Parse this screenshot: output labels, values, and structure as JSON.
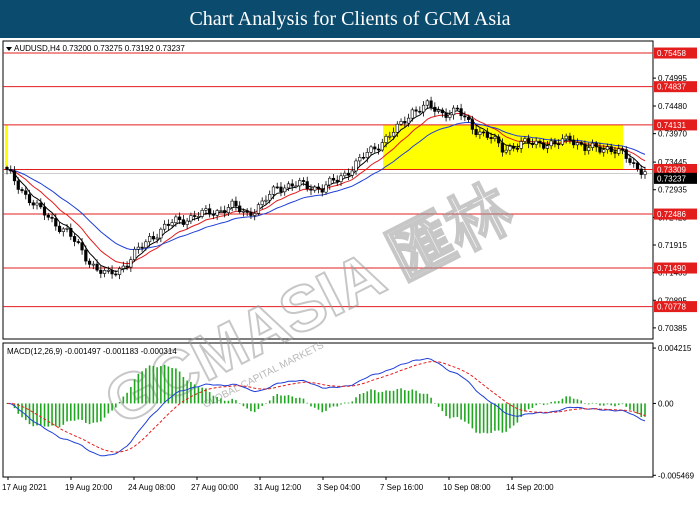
{
  "header": {
    "title": "Chart Analysis for Clients of GCM Asia"
  },
  "watermark": {
    "text": "GCMASIA 匯林",
    "sub": "GLOBAL CAPITAL MARKETS"
  },
  "chart_data": [
    {
      "type": "candlestick",
      "title": "AUDUSD,H4 0.73200 0.73275 0.73192 0.73237",
      "symbol_label": "AUDUSD,H4",
      "ohlc": {
        "open": 0.732,
        "high": 0.73275,
        "low": 0.73192,
        "close": 0.73237
      },
      "x_tick_labels": [
        "17 Aug 2021",
        "19 Aug 20:00",
        "24 Aug 08:00",
        "27 Aug 00:00",
        "31 Aug 12:00",
        "3 Sep 04:00",
        "7 Sep 16:00",
        "10 Sep 08:00",
        "14 Sep 20:00"
      ],
      "y_tick_labels": [
        "0.74995",
        "0.74480",
        "0.73970",
        "0.73445",
        "0.72935",
        "0.72425",
        "0.71915",
        "0.71405",
        "0.70895",
        "0.70385"
      ],
      "y_ticks": [
        0.74995,
        0.7448,
        0.7397,
        0.73445,
        0.72935,
        0.72425,
        0.71915,
        0.71405,
        0.70895,
        0.70385
      ],
      "ylim": [
        0.7018,
        0.7568
      ],
      "horizontal_levels": [
        0.75458,
        0.74837,
        0.74131,
        0.73309,
        0.72486,
        0.7149,
        0.70778
      ],
      "horizontal_level_labels": [
        "0.75458",
        "0.74837",
        "0.74131",
        "0.73309",
        "0.72486",
        "0.71490",
        "0.70778"
      ],
      "current_price_label": "0.73237",
      "current_price": 0.73237,
      "highlight_zone": {
        "from": 0.73309,
        "to": 0.74131,
        "color": "#ffff00"
      },
      "moving_averages": [
        {
          "color": "#000000"
        },
        {
          "color": "#e31c1c"
        },
        {
          "color": "#1f3fd6"
        }
      ],
      "colors": {
        "level_line": "#e31c1c",
        "label_bg": "#e31c1c",
        "current_bg": "#000000"
      }
    },
    {
      "type": "macd",
      "title": "MACD(12,26,9) -0.001497 -0.001183 -0.000314",
      "y_tick_labels": [
        "0.004215",
        "0.00",
        "-0.005469"
      ],
      "y_ticks": [
        0.004215,
        0.0,
        -0.005469
      ],
      "ylim": [
        -0.0056,
        0.0046
      ],
      "colors": {
        "histogram": "#1fa81f",
        "macd": "#1f3fd6",
        "signal": "#e31c1c"
      }
    }
  ]
}
